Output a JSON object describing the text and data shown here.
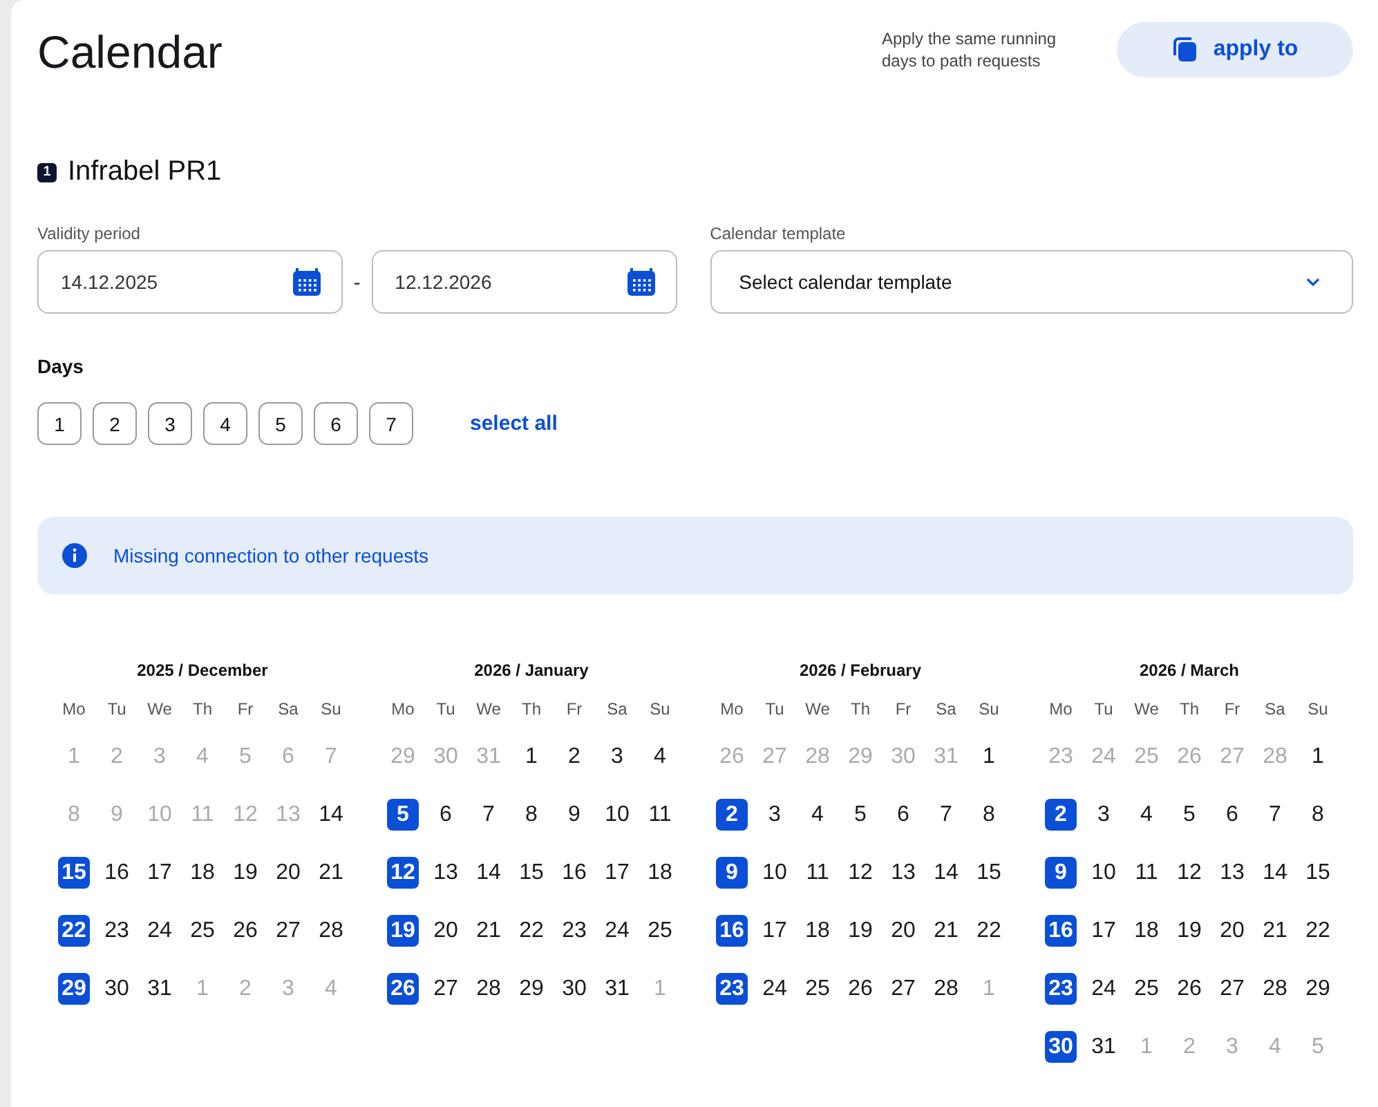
{
  "title": "Calendar",
  "apply_hint": "Apply the same running days to path requests",
  "apply_button": "apply to",
  "request": {
    "number": "1",
    "name": "Infrabel PR1"
  },
  "validity": {
    "label": "Validity period",
    "from": "14.12.2025",
    "separator": "-",
    "to": "12.12.2026"
  },
  "template": {
    "label": "Calendar template",
    "placeholder": "Select calendar template"
  },
  "days": {
    "label": "Days",
    "items": [
      {
        "label": "1",
        "selected": false
      },
      {
        "label": "2",
        "selected": false
      },
      {
        "label": "3",
        "selected": false
      },
      {
        "label": "4",
        "selected": false
      },
      {
        "label": "5",
        "selected": false
      },
      {
        "label": "6",
        "selected": false
      },
      {
        "label": "7",
        "selected": false
      }
    ],
    "select_all": "select all"
  },
  "info": "Missing connection to other requests",
  "months": [
    {
      "title": "2025 / December",
      "weekdays": [
        "Mo",
        "Tu",
        "We",
        "Th",
        "Fr",
        "Sa",
        "Su"
      ],
      "weeks": [
        [
          {
            "day": "1",
            "muted": true,
            "selected": false
          },
          {
            "day": "2",
            "muted": true,
            "selected": false
          },
          {
            "day": "3",
            "muted": true,
            "selected": false
          },
          {
            "day": "4",
            "muted": true,
            "selected": false
          },
          {
            "day": "5",
            "muted": true,
            "selected": false
          },
          {
            "day": "6",
            "muted": true,
            "selected": false
          },
          {
            "day": "7",
            "muted": true,
            "selected": false
          }
        ],
        [
          {
            "day": "8",
            "muted": true,
            "selected": false
          },
          {
            "day": "9",
            "muted": true,
            "selected": false
          },
          {
            "day": "10",
            "muted": true,
            "selected": false
          },
          {
            "day": "11",
            "muted": true,
            "selected": false
          },
          {
            "day": "12",
            "muted": true,
            "selected": false
          },
          {
            "day": "13",
            "muted": true,
            "selected": false
          },
          {
            "day": "14",
            "muted": false,
            "selected": false
          }
        ],
        [
          {
            "day": "15",
            "muted": false,
            "selected": true
          },
          {
            "day": "16",
            "muted": false,
            "selected": false
          },
          {
            "day": "17",
            "muted": false,
            "selected": false
          },
          {
            "day": "18",
            "muted": false,
            "selected": false
          },
          {
            "day": "19",
            "muted": false,
            "selected": false
          },
          {
            "day": "20",
            "muted": false,
            "selected": false
          },
          {
            "day": "21",
            "muted": false,
            "selected": false
          }
        ],
        [
          {
            "day": "22",
            "muted": false,
            "selected": true
          },
          {
            "day": "23",
            "muted": false,
            "selected": false
          },
          {
            "day": "24",
            "muted": false,
            "selected": false
          },
          {
            "day": "25",
            "muted": false,
            "selected": false
          },
          {
            "day": "26",
            "muted": false,
            "selected": false
          },
          {
            "day": "27",
            "muted": false,
            "selected": false
          },
          {
            "day": "28",
            "muted": false,
            "selected": false
          }
        ],
        [
          {
            "day": "29",
            "muted": false,
            "selected": true
          },
          {
            "day": "30",
            "muted": false,
            "selected": false
          },
          {
            "day": "31",
            "muted": false,
            "selected": false
          },
          {
            "day": "1",
            "muted": true,
            "selected": false
          },
          {
            "day": "2",
            "muted": true,
            "selected": false
          },
          {
            "day": "3",
            "muted": true,
            "selected": false
          },
          {
            "day": "4",
            "muted": true,
            "selected": false
          }
        ]
      ]
    },
    {
      "title": "2026 / January",
      "weekdays": [
        "Mo",
        "Tu",
        "We",
        "Th",
        "Fr",
        "Sa",
        "Su"
      ],
      "weeks": [
        [
          {
            "day": "29",
            "muted": true,
            "selected": false
          },
          {
            "day": "30",
            "muted": true,
            "selected": false
          },
          {
            "day": "31",
            "muted": true,
            "selected": false
          },
          {
            "day": "1",
            "muted": false,
            "selected": false
          },
          {
            "day": "2",
            "muted": false,
            "selected": false
          },
          {
            "day": "3",
            "muted": false,
            "selected": false
          },
          {
            "day": "4",
            "muted": false,
            "selected": false
          }
        ],
        [
          {
            "day": "5",
            "muted": false,
            "selected": true
          },
          {
            "day": "6",
            "muted": false,
            "selected": false
          },
          {
            "day": "7",
            "muted": false,
            "selected": false
          },
          {
            "day": "8",
            "muted": false,
            "selected": false
          },
          {
            "day": "9",
            "muted": false,
            "selected": false
          },
          {
            "day": "10",
            "muted": false,
            "selected": false
          },
          {
            "day": "11",
            "muted": false,
            "selected": false
          }
        ],
        [
          {
            "day": "12",
            "muted": false,
            "selected": true
          },
          {
            "day": "13",
            "muted": false,
            "selected": false
          },
          {
            "day": "14",
            "muted": false,
            "selected": false
          },
          {
            "day": "15",
            "muted": false,
            "selected": false
          },
          {
            "day": "16",
            "muted": false,
            "selected": false
          },
          {
            "day": "17",
            "muted": false,
            "selected": false
          },
          {
            "day": "18",
            "muted": false,
            "selected": false
          }
        ],
        [
          {
            "day": "19",
            "muted": false,
            "selected": true
          },
          {
            "day": "20",
            "muted": false,
            "selected": false
          },
          {
            "day": "21",
            "muted": false,
            "selected": false
          },
          {
            "day": "22",
            "muted": false,
            "selected": false
          },
          {
            "day": "23",
            "muted": false,
            "selected": false
          },
          {
            "day": "24",
            "muted": false,
            "selected": false
          },
          {
            "day": "25",
            "muted": false,
            "selected": false
          }
        ],
        [
          {
            "day": "26",
            "muted": false,
            "selected": true
          },
          {
            "day": "27",
            "muted": false,
            "selected": false
          },
          {
            "day": "28",
            "muted": false,
            "selected": false
          },
          {
            "day": "29",
            "muted": false,
            "selected": false
          },
          {
            "day": "30",
            "muted": false,
            "selected": false
          },
          {
            "day": "31",
            "muted": false,
            "selected": false
          },
          {
            "day": "1",
            "muted": true,
            "selected": false
          }
        ]
      ]
    },
    {
      "title": "2026 / February",
      "weekdays": [
        "Mo",
        "Tu",
        "We",
        "Th",
        "Fr",
        "Sa",
        "Su"
      ],
      "weeks": [
        [
          {
            "day": "26",
            "muted": true,
            "selected": false
          },
          {
            "day": "27",
            "muted": true,
            "selected": false
          },
          {
            "day": "28",
            "muted": true,
            "selected": false
          },
          {
            "day": "29",
            "muted": true,
            "selected": false
          },
          {
            "day": "30",
            "muted": true,
            "selected": false
          },
          {
            "day": "31",
            "muted": true,
            "selected": false
          },
          {
            "day": "1",
            "muted": false,
            "selected": false
          }
        ],
        [
          {
            "day": "2",
            "muted": false,
            "selected": true
          },
          {
            "day": "3",
            "muted": false,
            "selected": false
          },
          {
            "day": "4",
            "muted": false,
            "selected": false
          },
          {
            "day": "5",
            "muted": false,
            "selected": false
          },
          {
            "day": "6",
            "muted": false,
            "selected": false
          },
          {
            "day": "7",
            "muted": false,
            "selected": false
          },
          {
            "day": "8",
            "muted": false,
            "selected": false
          }
        ],
        [
          {
            "day": "9",
            "muted": false,
            "selected": true
          },
          {
            "day": "10",
            "muted": false,
            "selected": false
          },
          {
            "day": "11",
            "muted": false,
            "selected": false
          },
          {
            "day": "12",
            "muted": false,
            "selected": false
          },
          {
            "day": "13",
            "muted": false,
            "selected": false
          },
          {
            "day": "14",
            "muted": false,
            "selected": false
          },
          {
            "day": "15",
            "muted": false,
            "selected": false
          }
        ],
        [
          {
            "day": "16",
            "muted": false,
            "selected": true
          },
          {
            "day": "17",
            "muted": false,
            "selected": false
          },
          {
            "day": "18",
            "muted": false,
            "selected": false
          },
          {
            "day": "19",
            "muted": false,
            "selected": false
          },
          {
            "day": "20",
            "muted": false,
            "selected": false
          },
          {
            "day": "21",
            "muted": false,
            "selected": false
          },
          {
            "day": "22",
            "muted": false,
            "selected": false
          }
        ],
        [
          {
            "day": "23",
            "muted": false,
            "selected": true
          },
          {
            "day": "24",
            "muted": false,
            "selected": false
          },
          {
            "day": "25",
            "muted": false,
            "selected": false
          },
          {
            "day": "26",
            "muted": false,
            "selected": false
          },
          {
            "day": "27",
            "muted": false,
            "selected": false
          },
          {
            "day": "28",
            "muted": false,
            "selected": false
          },
          {
            "day": "1",
            "muted": true,
            "selected": false
          }
        ]
      ]
    },
    {
      "title": "2026 / March",
      "weekdays": [
        "Mo",
        "Tu",
        "We",
        "Th",
        "Fr",
        "Sa",
        "Su"
      ],
      "weeks": [
        [
          {
            "day": "23",
            "muted": true,
            "selected": false
          },
          {
            "day": "24",
            "muted": true,
            "selected": false
          },
          {
            "day": "25",
            "muted": true,
            "selected": false
          },
          {
            "day": "26",
            "muted": true,
            "selected": false
          },
          {
            "day": "27",
            "muted": true,
            "selected": false
          },
          {
            "day": "28",
            "muted": true,
            "selected": false
          },
          {
            "day": "1",
            "muted": false,
            "selected": false
          }
        ],
        [
          {
            "day": "2",
            "muted": false,
            "selected": true
          },
          {
            "day": "3",
            "muted": false,
            "selected": false
          },
          {
            "day": "4",
            "muted": false,
            "selected": false
          },
          {
            "day": "5",
            "muted": false,
            "selected": false
          },
          {
            "day": "6",
            "muted": false,
            "selected": false
          },
          {
            "day": "7",
            "muted": false,
            "selected": false
          },
          {
            "day": "8",
            "muted": false,
            "selected": false
          }
        ],
        [
          {
            "day": "9",
            "muted": false,
            "selected": true
          },
          {
            "day": "10",
            "muted": false,
            "selected": false
          },
          {
            "day": "11",
            "muted": false,
            "selected": false
          },
          {
            "day": "12",
            "muted": false,
            "selected": false
          },
          {
            "day": "13",
            "muted": false,
            "selected": false
          },
          {
            "day": "14",
            "muted": false,
            "selected": false
          },
          {
            "day": "15",
            "muted": false,
            "selected": false
          }
        ],
        [
          {
            "day": "16",
            "muted": false,
            "selected": true
          },
          {
            "day": "17",
            "muted": false,
            "selected": false
          },
          {
            "day": "18",
            "muted": false,
            "selected": false
          },
          {
            "day": "19",
            "muted": false,
            "selected": false
          },
          {
            "day": "20",
            "muted": false,
            "selected": false
          },
          {
            "day": "21",
            "muted": false,
            "selected": false
          },
          {
            "day": "22",
            "muted": false,
            "selected": false
          }
        ],
        [
          {
            "day": "23",
            "muted": false,
            "selected": true
          },
          {
            "day": "24",
            "muted": false,
            "selected": false
          },
          {
            "day": "25",
            "muted": false,
            "selected": false
          },
          {
            "day": "26",
            "muted": false,
            "selected": false
          },
          {
            "day": "27",
            "muted": false,
            "selected": false
          },
          {
            "day": "28",
            "muted": false,
            "selected": false
          },
          {
            "day": "29",
            "muted": false,
            "selected": false
          }
        ],
        [
          {
            "day": "30",
            "muted": false,
            "selected": true
          },
          {
            "day": "31",
            "muted": false,
            "selected": false
          },
          {
            "day": "1",
            "muted": true,
            "selected": false
          },
          {
            "day": "2",
            "muted": true,
            "selected": false
          },
          {
            "day": "3",
            "muted": true,
            "selected": false
          },
          {
            "day": "4",
            "muted": true,
            "selected": false
          },
          {
            "day": "5",
            "muted": true,
            "selected": false
          }
        ]
      ]
    }
  ]
}
